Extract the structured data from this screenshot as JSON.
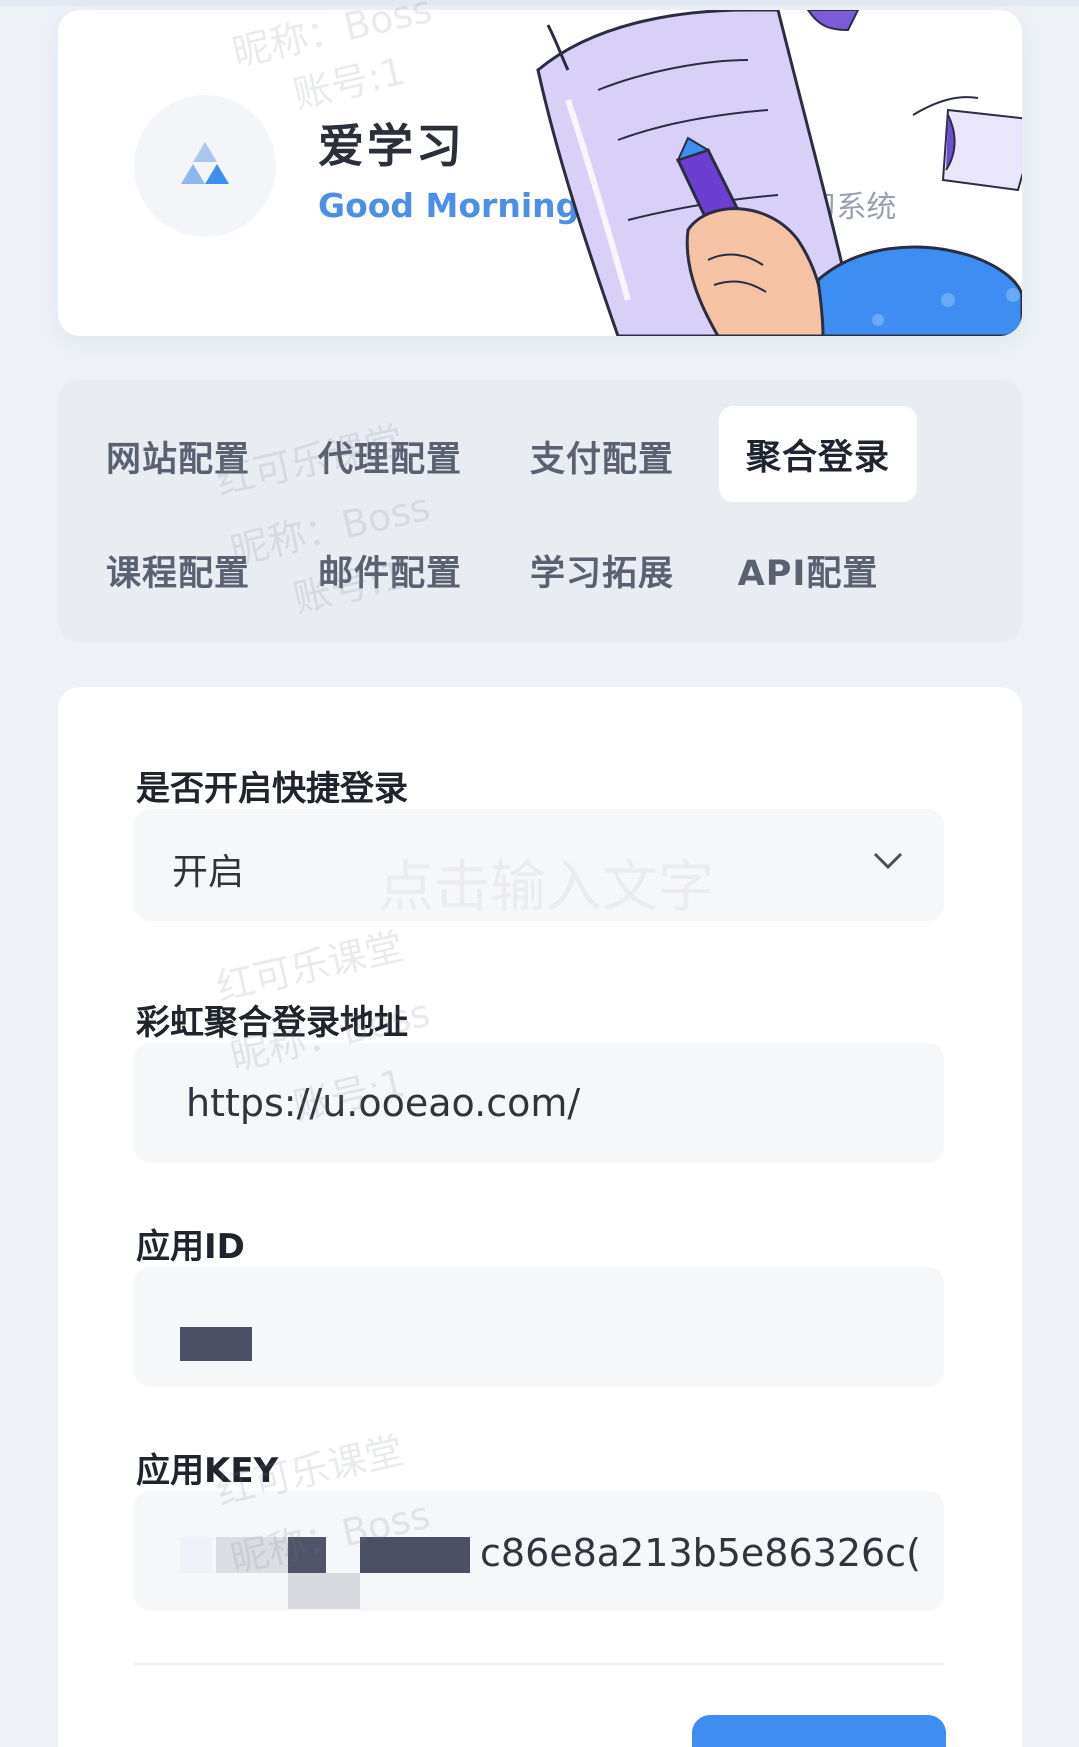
{
  "header": {
    "app_title": "爱学习",
    "greeting": "Good Morning",
    "separator": "|",
    "welcome": "欢迎使用爱学习系统"
  },
  "tabs": [
    {
      "label": "网站配置",
      "active": false
    },
    {
      "label": "代理配置",
      "active": false
    },
    {
      "label": "支付配置",
      "active": false
    },
    {
      "label": "聚合登录",
      "active": true
    },
    {
      "label": "课程配置",
      "active": false
    },
    {
      "label": "邮件配置",
      "active": false
    },
    {
      "label": "学习拓展",
      "active": false
    },
    {
      "label": "API配置",
      "active": false
    }
  ],
  "form": {
    "quick_login": {
      "label": "是否开启快捷登录",
      "value": "开启"
    },
    "rainbow_url": {
      "label": "彩虹聚合登录地址",
      "value": "https://u.ooeao.com/"
    },
    "app_id": {
      "label": "应用ID"
    },
    "app_key": {
      "label": "应用KEY",
      "value_visible": "c86e8a213b5e86326c("
    }
  },
  "watermark": {
    "line1": "红可乐课堂",
    "line2": "昵称：Boss",
    "line3": "账号:1",
    "center_hint": "点击输入文字"
  },
  "colors": {
    "accent": "#3d8ef0",
    "greeting": "#4b8fe8",
    "background": "#eef2f7"
  }
}
